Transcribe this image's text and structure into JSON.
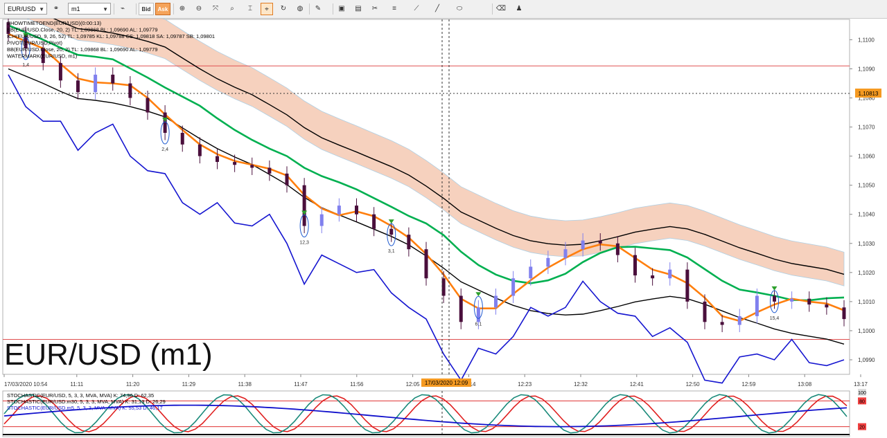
{
  "toolbar": {
    "symbol": "EUR/USD",
    "timeframe": "m1",
    "bid_label": "Bid",
    "ask_label": "Ask"
  },
  "indicator_legend": [
    {
      "text": "SHOWTIMETOEND(EUR/USD)(0:00:13)",
      "color": "#000000"
    },
    {
      "text": "BB(EUR/USD.Close, 20, 2)  TL: 1,09868  BL: 1,09690  AL: 1,09779",
      "color": "#000000"
    },
    {
      "text": "ICH(EUR/USD, 9, 26, 52)  TL: 1,09785  KL: 1,09788  CS: 1,09818  SA: 1,09787  SB: 1,09801",
      "color": "#000000"
    },
    {
      "text": "PIVOT(EUR/USD,Pivot)",
      "color": "#000000"
    },
    {
      "text": "BB(EUR/USD.Close, 20, 2)  TL: 1,09868  BL: 1,09690  AL: 1,09779",
      "color": "#000000"
    },
    {
      "text": "WATERMARK(EUR/USD, m1)",
      "color": "#000000"
    }
  ],
  "watermark": "EUR/USD (m1)",
  "current_price_label": "1,10813",
  "crosshair_time_label": "17/03/2020 12:09",
  "stoch_legend": [
    {
      "text": "STOCHASTIC(EUR/USD, 5, 3, 3, MVA, MVA)  K: 74,96  D: 62,35",
      "color": "#000000"
    },
    {
      "text": "STOCHASTIC(EUR/USD.m30, 5, 3, 3, MVA, MVA)  K: 31,13  D: 26,29",
      "color": "#000000"
    },
    {
      "text": "STOCHASTIC(EUR/USD.m5, 5, 3, 3, MVA, MVA)  K: 55,53  D: 46,17",
      "color": "#1010cc"
    }
  ],
  "stoch_levels": [
    "100",
    "80",
    "20"
  ],
  "markers": [
    {
      "label": "1,4"
    },
    {
      "label": "2,4"
    },
    {
      "label": "12,3"
    },
    {
      "label": "3,1"
    },
    {
      "label": "6,1"
    },
    {
      "label": "15,4"
    }
  ],
  "colors": {
    "bull_candle": "#8080ee",
    "bear_candle": "#4a0f3c",
    "bb_line": "#000000",
    "tenkan": "#ff7f0e",
    "kijun": "#00b050",
    "chikou": "#1515d0",
    "cloud_fill": "#f5c9b3",
    "pivot_line": "#e05050",
    "crosshair_label_bg": "#f59a22"
  },
  "chart_data": {
    "type": "line",
    "title": "EUR/USD (m1)",
    "y_axis_ticks": [
      "1,1100",
      "1,1090",
      "1,1080",
      "1,1070",
      "1,1060",
      "1,1050",
      "1,1040",
      "1,1030",
      "1,1020",
      "1,1010",
      "1,1000",
      "1,0990"
    ],
    "x_axis_ticks": [
      "17/03/2020 10:54",
      "11:11",
      "11:20",
      "11:29",
      "11:38",
      "11:47",
      "11:56",
      "12:05",
      "12:14",
      "12:23",
      "12:32",
      "12:41",
      "12:50",
      "12:59",
      "13:08",
      "13:17"
    ],
    "ylim": [
      1.0985,
      1.1107
    ],
    "pivot_levels": [
      1.1091,
      1.0997
    ],
    "series": [
      {
        "name": "Close",
        "x": [
          "10:54",
          "10:57",
          "11:00",
          "11:03",
          "11:06",
          "11:09",
          "11:12",
          "11:15",
          "11:18",
          "11:21",
          "11:24",
          "11:27",
          "11:30",
          "11:33",
          "11:36",
          "11:39",
          "11:42",
          "11:45",
          "11:48",
          "11:51",
          "11:54",
          "11:57",
          "12:00",
          "12:03",
          "12:06",
          "12:09",
          "12:12",
          "12:15",
          "12:18",
          "12:21",
          "12:24",
          "12:27",
          "12:30",
          "12:33",
          "12:36",
          "12:39",
          "12:42",
          "12:45",
          "12:48",
          "12:51",
          "12:54",
          "12:57",
          "13:00",
          "13:03",
          "13:06",
          "13:09",
          "13:12",
          "13:15",
          "13:18"
        ],
        "values": [
          1.1102,
          1.1097,
          1.1092,
          1.1086,
          1.1082,
          1.1088,
          1.1085,
          1.108,
          1.1075,
          1.1068,
          1.1064,
          1.106,
          1.1058,
          1.1057,
          1.1056,
          1.1054,
          1.105,
          1.1036,
          1.104,
          1.1043,
          1.104,
          1.1035,
          1.1033,
          1.1028,
          1.1018,
          1.1012,
          1.1003,
          1.1008,
          1.1012,
          1.1018,
          1.1022,
          1.1025,
          1.1028,
          1.1031,
          1.103,
          1.1026,
          1.1019,
          1.1018,
          1.1021,
          1.101,
          1.1003,
          1.1002,
          1.1005,
          1.1012,
          1.101,
          1.1011,
          1.1009,
          1.1008,
          1.1004
        ]
      }
    ]
  },
  "stoch_data": {
    "ylim": [
      0,
      100
    ],
    "levels": [
      80,
      20
    ]
  }
}
